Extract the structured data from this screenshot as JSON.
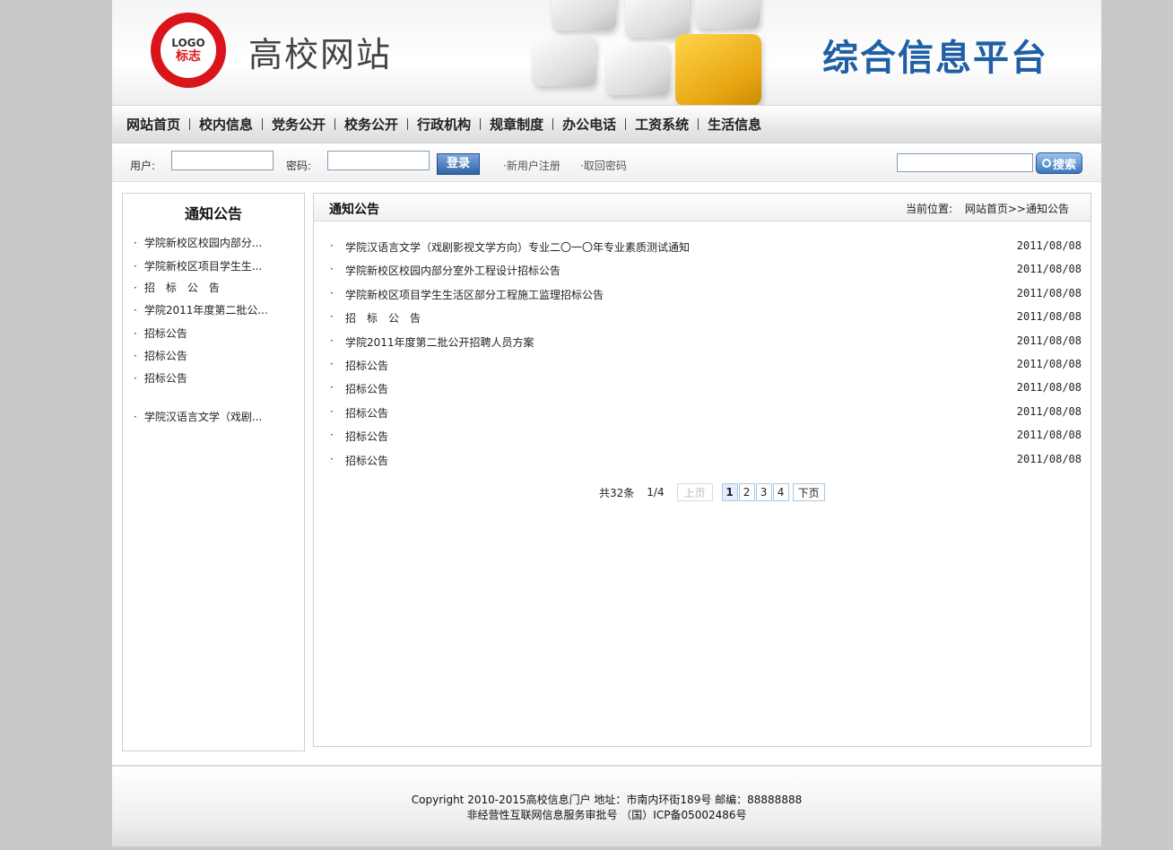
{
  "header": {
    "logo_text_1": "LOGO",
    "logo_text_2": "标志",
    "site_name": "高校网站",
    "platform_name": "综合信息平台"
  },
  "nav": {
    "items": [
      "网站首页",
      "校内信息",
      "党务公开",
      "校务公开",
      "行政机构",
      "规章制度",
      "办公电话",
      "工资系统",
      "生活信息"
    ]
  },
  "login": {
    "user_label": "用户:",
    "password_label": "密码:",
    "login_button": "登录",
    "register_link": "·新用户注册",
    "recover_link": "·取回密码",
    "search_button": "搜索"
  },
  "left": {
    "title": "通知公告",
    "items": [
      "学院新校区校园内部分...",
      "学院新校区项目学生生...",
      "招　标　公　告",
      "学院2011年度第二批公...",
      "招标公告",
      "招标公告",
      "招标公告",
      "学院汉语言文学（戏剧..."
    ]
  },
  "main": {
    "title": "通知公告",
    "breadcrumb_label": "当前位置:",
    "breadcrumb_home": "网站首页",
    "breadcrumb_sep": ">>",
    "breadcrumb_current": "通知公告",
    "rows": [
      {
        "title": "学院汉语言文学（戏剧影视文学方向）专业二〇一〇年专业素质测试通知",
        "date": "2011/08/08"
      },
      {
        "title": "学院新校区校园内部分室外工程设计招标公告",
        "date": "2011/08/08"
      },
      {
        "title": "学院新校区项目学生生活区部分工程施工监理招标公告",
        "date": "2011/08/08"
      },
      {
        "title": "招　标　公　告",
        "date": "2011/08/08"
      },
      {
        "title": "学院2011年度第二批公开招聘人员方案",
        "date": "2011/08/08"
      },
      {
        "title": "招标公告",
        "date": "2011/08/08"
      },
      {
        "title": "招标公告",
        "date": "2011/08/08"
      },
      {
        "title": "招标公告",
        "date": "2011/08/08"
      },
      {
        "title": "招标公告",
        "date": "2011/08/08"
      },
      {
        "title": "招标公告",
        "date": "2011/08/08"
      }
    ],
    "pager": {
      "total": "共32条",
      "page_of": "1/4",
      "prev": "上页",
      "pages": [
        "1",
        "2",
        "3",
        "4"
      ],
      "next": "下页"
    }
  },
  "footer": {
    "line1": "Copyright 2010-2015高校信息门户 地址：市南内环街189号 邮编：88888888",
    "line2": "非经营性互联网信息服务审批号 （国）ICP备05002486号"
  },
  "colors": {
    "accent_blue": "#1f5fa6",
    "logo_red": "#d9141b",
    "key_gold": "#e7a511",
    "background": "#c9c9c9"
  }
}
